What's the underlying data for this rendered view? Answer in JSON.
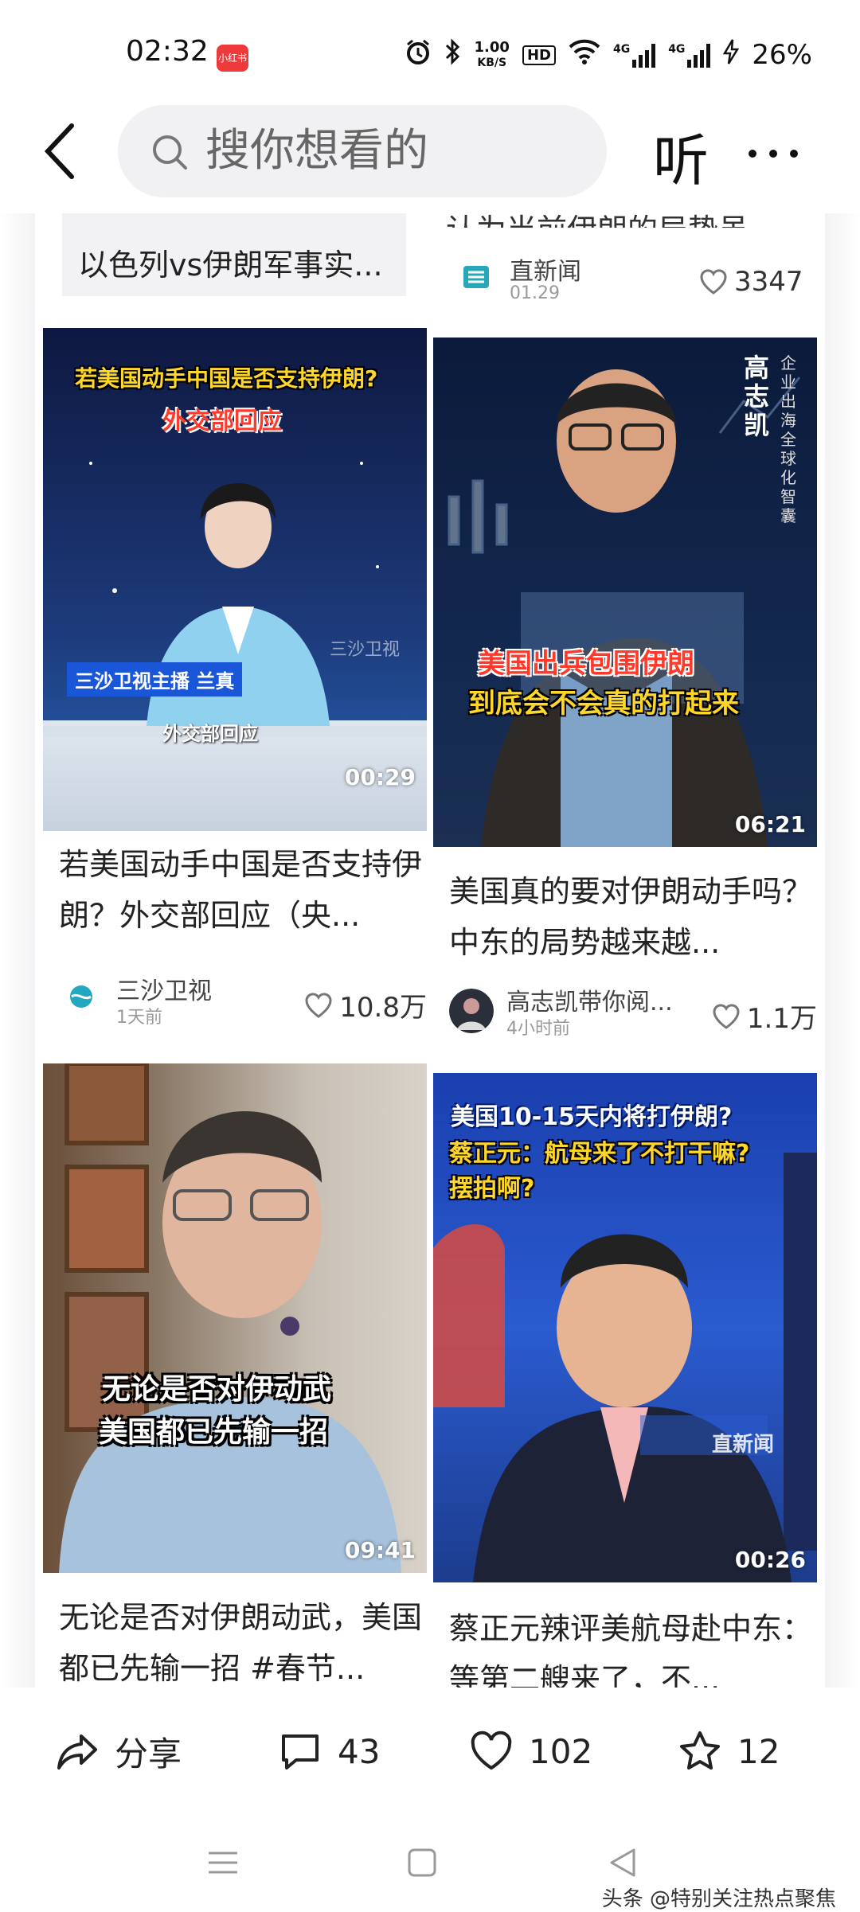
{
  "status": {
    "time": "02:32",
    "app_badge": "小红书",
    "net_speed_value": "1.00",
    "net_speed_unit": "KB/S",
    "hd": "HD",
    "sig1": "4G",
    "sig2": "4G",
    "battery": "26%"
  },
  "header": {
    "search_placeholder": "搜你想看的",
    "listen_label": "听"
  },
  "top_cards": {
    "left_title": "以色列vs伊朗军事实...",
    "right_title": "认为当前伊朗的局势虽...",
    "right_author": "直新闻",
    "right_time": "01.29",
    "right_likes": "3347"
  },
  "cards": [
    {
      "title": "若美国动手中国是否支持伊朗？外交部回应（央...",
      "overlay_top": "若美国动手中国是否支持伊朗?",
      "overlay_sub": "外交部回应",
      "overlay_caption": "三沙卫视主播 兰真",
      "overlay_caption2": "外交部回应",
      "overlay_logo": "三沙卫视",
      "duration": "00:29",
      "author": "三沙卫视",
      "time": "1天前",
      "likes": "10.8万"
    },
    {
      "title": "美国真的要对伊朗动手吗？ 中东的局势越来越...",
      "overlay_name": "高志凯",
      "overlay_role": "企业出海全球化智囊",
      "overlay_line1": "美国出兵包围伊朗",
      "overlay_line2": "到底会不会真的打起来",
      "duration": "06:21",
      "author": "高志凯带你阅...",
      "time": "4小时前",
      "likes": "1.1万"
    },
    {
      "title": "无论是否对伊朗动武，美国都已先输一招 #春节...",
      "overlay_line1": "无论是否对伊动武",
      "overlay_line2": "美国都已先输一招",
      "duration": "09:41"
    },
    {
      "title": "蔡正元辣评美航母赴中东：等第二艘来了，不...",
      "overlay_line1": "美国10-15天内将打伊朗?",
      "overlay_line2": "蔡正元：航母来了不打干嘛?",
      "overlay_line3": "摆拍啊?",
      "overlay_logo": "直新闻",
      "duration": "00:26"
    }
  ],
  "actions": {
    "share_label": "分享",
    "comments": "43",
    "likes": "102",
    "favorites": "12"
  },
  "watermark": "头条 @特别关注热点聚焦",
  "colors": {
    "accent_red": "#ee3a3a",
    "overlay_yellow": "#ffd62a",
    "search_bg": "#f1f1f3"
  }
}
